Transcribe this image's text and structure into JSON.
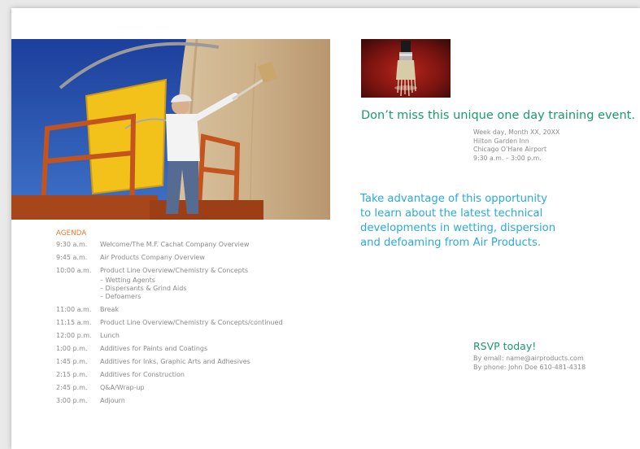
{
  "agenda": {
    "title": "AGENDA",
    "items": [
      {
        "time": "9:30 a.m.",
        "desc": "Welcome/The M.F. Cachat Company Overview"
      },
      {
        "time": "9:45 a.m.",
        "desc": "Air Products Company Overview"
      },
      {
        "time": "10:00 a.m.",
        "desc": "Product Line Overview/Chemistry & Concepts"
      },
      {
        "time": "11:00 a.m.",
        "desc": "Break"
      },
      {
        "time": "11:15 a.m.",
        "desc": "Product Line Overview/Chemistry & Concepts/continued"
      },
      {
        "time": "12:00 p.m.",
        "desc": "Lunch"
      },
      {
        "time": "1:00 p.m.",
        "desc": "Additives for Paints and Coatings"
      },
      {
        "time": "1:45 p.m.",
        "desc": "Additives for Inks, Graphic Arts and Adhesives"
      },
      {
        "time": "2:15 p.m.",
        "desc": "Additives for Construction"
      },
      {
        "time": "2:45 p.m.",
        "desc": "Q&A/Wrap-up"
      },
      {
        "time": "3:00 p.m.",
        "desc": "Adjourn"
      }
    ],
    "subitems": [
      "– Wetting Agents",
      "– Dispersants & Grind Aids",
      "– Defoamers"
    ]
  },
  "headline": "Don’t miss this unique one day training event.",
  "event": {
    "date": "Week day, Month XX, 20XX",
    "venue": "Hilton Garden Inn",
    "location": "Chicago O’Hare Airport",
    "hours": "9:30 a.m. – 3:00 p.m."
  },
  "blurb": [
    "Take advantage of this opportunity",
    "to learn about the latest technical",
    "developments in wetting, dispersion",
    "and defoaming from Air Products."
  ],
  "rsvp": {
    "title": "RSVP today!",
    "email": "By email: name@airproducts.com",
    "phone": "By phone: John Doe 610-481-4318"
  },
  "colors": {
    "accent_orange": "#e07a2e",
    "headline_green": "#1a9a6a",
    "blurb_blue": "#2aa9de",
    "body_gray": "#8a8a8a"
  }
}
